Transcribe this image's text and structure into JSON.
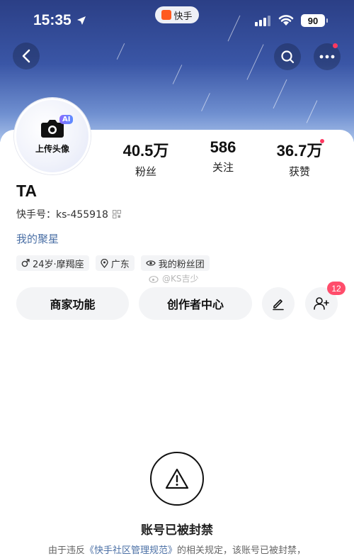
{
  "status_bar": {
    "time": "15:35",
    "app_name": "快手",
    "battery": "90"
  },
  "profile": {
    "avatar_label": "上传头像",
    "ai_badge": "AI",
    "username": "TA",
    "uid": "快手号：ks-455918",
    "star_link": "我的聚星",
    "stats": [
      {
        "value": "40.5万",
        "label": "粉丝"
      },
      {
        "value": "586",
        "label": "关注"
      },
      {
        "value": "36.7万",
        "label": "获赞"
      }
    ],
    "tags": [
      {
        "icon": "male-icon",
        "text": "24岁·摩羯座"
      },
      {
        "icon": "location-icon",
        "text": "广东"
      },
      {
        "icon": "fan-group-icon",
        "text": "我的粉丝团"
      }
    ]
  },
  "watermark": "@KS吉少",
  "actions": {
    "merchant": "商家功能",
    "creator_center": "创作者中心",
    "friend_badge": "12"
  },
  "ban": {
    "title": "账号已被封禁",
    "desc_prefix": "由于违反",
    "desc_link": "《快手社区管理规范》",
    "desc_suffix": "的相关规定，该账号已被封禁，"
  },
  "colors": {
    "header_gradient_top": "#2b3f86",
    "link": "#4a6fa5",
    "badge": "#ff4d6b"
  }
}
